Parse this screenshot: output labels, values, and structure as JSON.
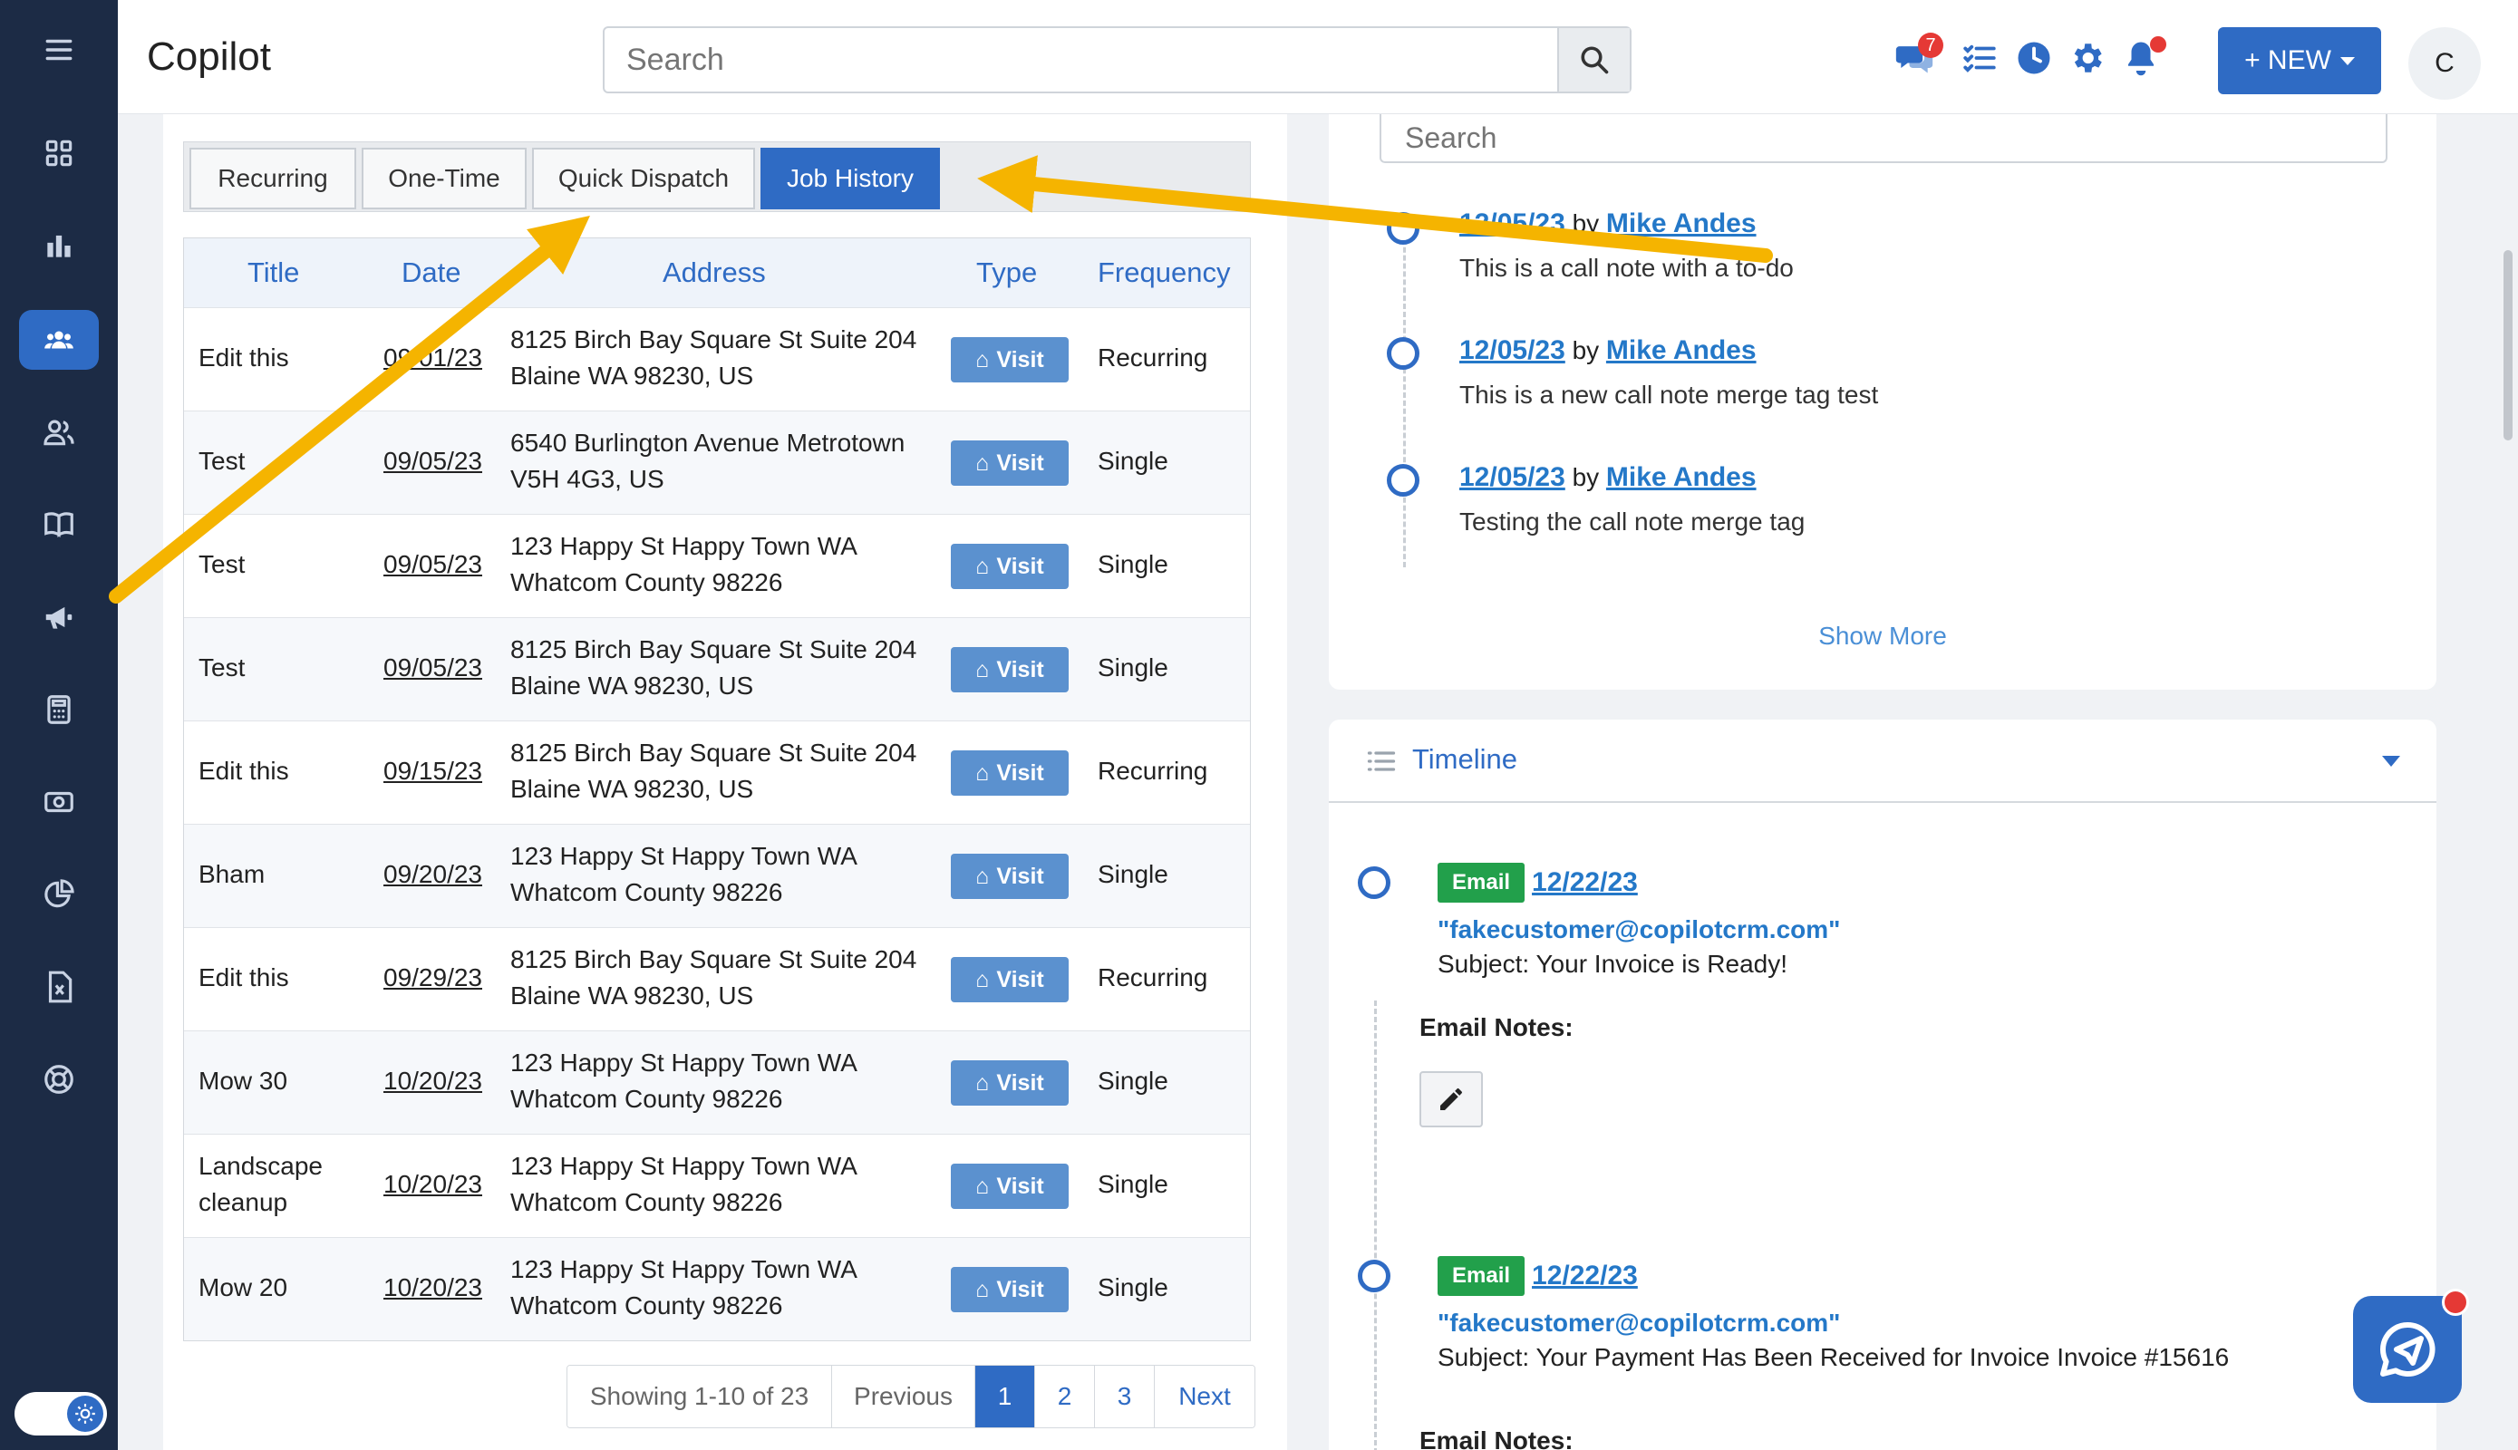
{
  "app": {
    "title": "Copilot"
  },
  "header": {
    "search_placeholder": "Search",
    "messages_badge": "7",
    "new_button_label": "+ NEW",
    "avatar_initial": "C"
  },
  "tabs": [
    {
      "label": "Recurring",
      "active": false
    },
    {
      "label": "One-Time",
      "active": false
    },
    {
      "label": "Quick Dispatch",
      "active": false
    },
    {
      "label": "Job History",
      "active": true
    }
  ],
  "job_table": {
    "columns": [
      "Title",
      "Date",
      "Address",
      "Type",
      "Frequency"
    ],
    "rows": [
      {
        "title": "Edit this",
        "date": "09/01/23",
        "addr1": "8125 Birch Bay Square St Suite 204",
        "addr2": "Blaine WA 98230, US",
        "type": "Visit",
        "frequency": "Recurring"
      },
      {
        "title": "Test",
        "date": "09/05/23",
        "addr1": "6540 Burlington Avenue Metrotown",
        "addr2": "V5H 4G3, US",
        "type": "Visit",
        "frequency": "Single"
      },
      {
        "title": "Test",
        "date": "09/05/23",
        "addr1": "123 Happy St Happy Town WA",
        "addr2": "Whatcom County 98226",
        "type": "Visit",
        "frequency": "Single"
      },
      {
        "title": "Test",
        "date": "09/05/23",
        "addr1": "8125 Birch Bay Square St Suite 204",
        "addr2": "Blaine WA 98230, US",
        "type": "Visit",
        "frequency": "Single"
      },
      {
        "title": "Edit this",
        "date": "09/15/23",
        "addr1": "8125 Birch Bay Square St Suite 204",
        "addr2": "Blaine WA 98230, US",
        "type": "Visit",
        "frequency": "Recurring"
      },
      {
        "title": "Bham",
        "date": "09/20/23",
        "addr1": "123 Happy St Happy Town WA",
        "addr2": "Whatcom County 98226",
        "type": "Visit",
        "frequency": "Single"
      },
      {
        "title": "Edit this",
        "date": "09/29/23",
        "addr1": "8125 Birch Bay Square St Suite 204",
        "addr2": "Blaine WA 98230, US",
        "type": "Visit",
        "frequency": "Recurring"
      },
      {
        "title": "Mow 30",
        "date": "10/20/23",
        "addr1": "123 Happy St Happy Town WA",
        "addr2": "Whatcom County 98226",
        "type": "Visit",
        "frequency": "Single"
      },
      {
        "title": "Landscape cleanup",
        "date": "10/20/23",
        "addr1": "123 Happy St Happy Town WA",
        "addr2": "Whatcom County 98226",
        "type": "Visit",
        "frequency": "Single"
      },
      {
        "title": "Mow 20",
        "date": "10/20/23",
        "addr1": "123 Happy St Happy Town WA",
        "addr2": "Whatcom County 98226",
        "type": "Visit",
        "frequency": "Single"
      }
    ]
  },
  "pagination": {
    "info": "Showing 1-10 of 23",
    "previous": "Previous",
    "pages": [
      "1",
      "2",
      "3"
    ],
    "current_page": "1",
    "next": "Next"
  },
  "call_notes": {
    "search_placeholder": "Search",
    "items": [
      {
        "date": "12/05/23",
        "by": "by",
        "author": "Mike Andes",
        "text": "This is a call note with a to-do"
      },
      {
        "date": "12/05/23",
        "by": "by",
        "author": "Mike Andes",
        "text": "This is a new call note merge tag test"
      },
      {
        "date": "12/05/23",
        "by": "by",
        "author": "Mike Andes",
        "text": "Testing the call note merge tag"
      }
    ],
    "show_more": "Show More"
  },
  "timeline": {
    "title": "Timeline",
    "items": [
      {
        "badge": "Email",
        "date": "12/22/23",
        "address": "\"fakecustomer@copilotcrm.com\"",
        "subject": "Subject: Your Invoice is Ready!",
        "notes_label": "Email Notes:"
      },
      {
        "badge": "Email",
        "date": "12/22/23",
        "address": "\"fakecustomer@copilotcrm.com\"",
        "subject": "Subject: Your Payment Has Been Received for Invoice Invoice #15616",
        "notes_label": "Email Notes:"
      }
    ]
  },
  "colors": {
    "sidebar_bg": "#1c2b45",
    "primary": "#2f6bc4",
    "link": "#2478c8",
    "email_badge": "#22a04b",
    "annotation_arrow": "#f5b400",
    "alert": "#e53935"
  }
}
